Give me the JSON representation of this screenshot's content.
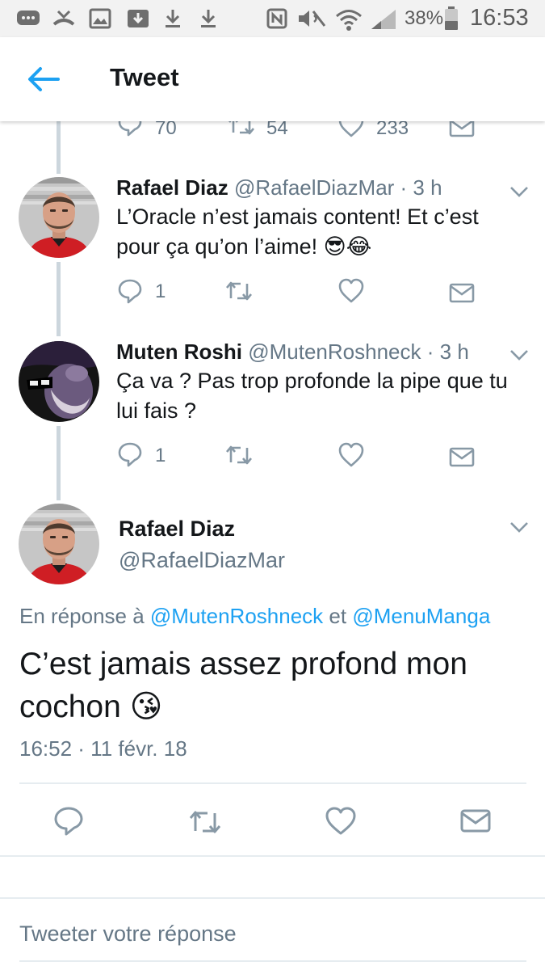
{
  "status_bar": {
    "battery": "38%",
    "time": "16:53"
  },
  "app_bar": {
    "title": "Tweet"
  },
  "previous_tweet_actions": {
    "replies": "70",
    "retweets": "54",
    "likes": "233"
  },
  "thread": [
    {
      "name": "Rafael Diaz",
      "handle": "@RafaelDiazMar",
      "time": "· 3 h",
      "text": "L’Oracle n’est jamais content! Et c’est pour ça qu’on l’aime! 😎😂",
      "replies": "1"
    },
    {
      "name": "Muten Roshi",
      "handle": "@MutenRoshneck",
      "time": "· 3 h",
      "text": "Ça va ? Pas trop profonde la pipe que tu lui fais ?",
      "replies": "1"
    }
  ],
  "main_tweet": {
    "name": "Rafael Diaz",
    "handle": "@RafaelDiazMar",
    "reply_prefix": "En réponse à",
    "mention1": "@MutenRoshneck",
    "reply_joiner": "et",
    "mention2": "@MenuManga",
    "text": "C’est jamais assez profond mon cochon 😘",
    "timestamp": "16:52 · 11 févr. 18"
  },
  "reply_box": {
    "placeholder": "Tweeter votre réponse"
  },
  "colors": {
    "accent": "#1da1f2",
    "secondary_text": "#657786",
    "icon_gray": "#8899a6",
    "divider": "#e6ecf0"
  }
}
